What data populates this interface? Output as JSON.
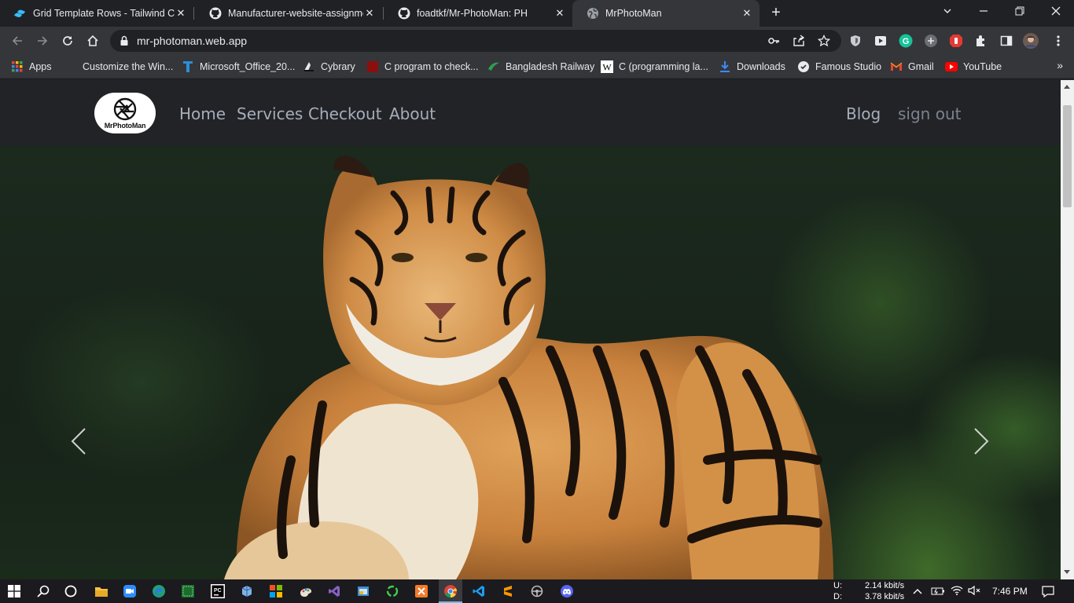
{
  "browser": {
    "tabs": [
      {
        "title": "Grid Template Rows - Tailwind CS",
        "favicon": "tailwind-icon"
      },
      {
        "title": "Manufacturer-website-assignmen",
        "favicon": "github-icon"
      },
      {
        "title": "foadtkf/Mr-PhotoMan: PH",
        "favicon": "github-icon"
      },
      {
        "title": "MrPhotoMan",
        "favicon": "globe-icon",
        "active": true
      }
    ],
    "address": "mr-photoman.web.app",
    "bookmarks": [
      {
        "label": "Apps"
      },
      {
        "label": "Customize the Win..."
      },
      {
        "label": "Microsoft_Office_20..."
      },
      {
        "label": "Cybrary"
      },
      {
        "label": "C program to check..."
      },
      {
        "label": "Bangladesh Railway"
      },
      {
        "label": "C (programming la..."
      },
      {
        "label": "Downloads"
      },
      {
        "label": "Famous Studio"
      },
      {
        "label": "Gmail"
      },
      {
        "label": "YouTube"
      }
    ]
  },
  "site": {
    "logo_text": "MrPhotoMan",
    "nav": {
      "home": "Home",
      "services": "Services",
      "checkout": "Checkout",
      "about": "About",
      "blog": "Blog",
      "signout": "sign out"
    },
    "hero_image": "tiger-photo"
  },
  "taskbar": {
    "net_up_label": "U:",
    "net_down_label": "D:",
    "net_up": "2.14 kbit/s",
    "net_down": "3.78 kbit/s",
    "time": "7:46 PM"
  },
  "colors": {
    "nav_bg": "#222326",
    "nav_link": "#a6adbb",
    "accent_active_tab": "#35363a"
  }
}
